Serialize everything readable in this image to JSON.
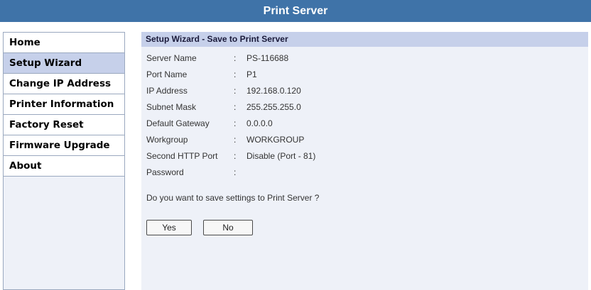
{
  "header": {
    "title": "Print Server"
  },
  "sidebar": {
    "items": [
      {
        "label": "Home"
      },
      {
        "label": "Setup Wizard"
      },
      {
        "label": "Change IP Address"
      },
      {
        "label": "Printer Information"
      },
      {
        "label": "Factory Reset"
      },
      {
        "label": "Firmware Upgrade"
      },
      {
        "label": "About"
      }
    ],
    "active": "Setup Wizard"
  },
  "panel": {
    "title": "Setup Wizard - Save to Print Server",
    "separator": ":",
    "rows": [
      {
        "label": "Server Name",
        "value": "PS-116688"
      },
      {
        "label": "Port Name",
        "value": "P1"
      },
      {
        "label": "IP Address",
        "value": "192.168.0.120"
      },
      {
        "label": "Subnet Mask",
        "value": "255.255.255.0"
      },
      {
        "label": "Default Gateway",
        "value": "0.0.0.0"
      },
      {
        "label": "Workgroup",
        "value": "WORKGROUP"
      },
      {
        "label": "Second HTTP Port",
        "value": "Disable (Port - 81)"
      },
      {
        "label": "Password",
        "value": ""
      }
    ],
    "question": "Do you want to save settings to Print Server ?",
    "yes_label": "Yes",
    "no_label": "No"
  },
  "colors": {
    "header_bg": "#3f73a8",
    "panel_header_bg": "#c6d0ea",
    "active_nav_bg": "#c6d0ea",
    "content_bg": "#eef1f8"
  }
}
